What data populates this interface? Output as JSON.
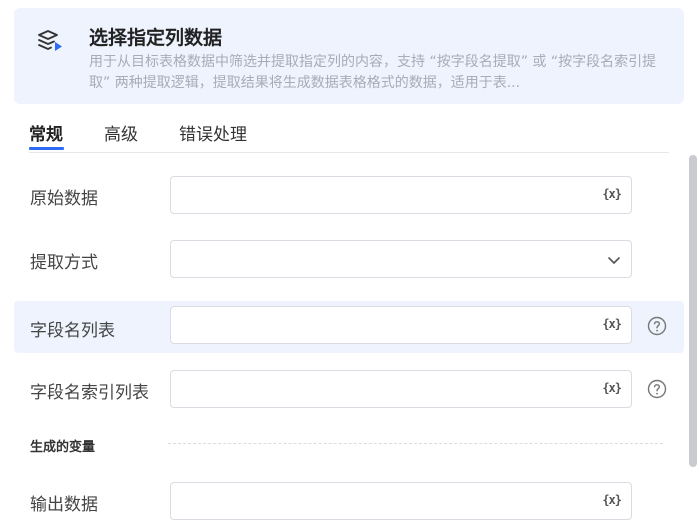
{
  "header": {
    "title": "选择指定列数据",
    "description": "用于从目标表格数据中筛选并提取指定列的内容，支持 “按字段名提取” 或 “按字段名索引提取” 两种提取逻辑，提取结果将生成数据表格格式的数据，适用于表...",
    "icon": "table-select-icon"
  },
  "tabs": [
    {
      "label": "常规",
      "active": true
    },
    {
      "label": "高级",
      "active": false
    },
    {
      "label": "错误处理",
      "active": false
    }
  ],
  "fields": {
    "raw_data": {
      "label": "原始数据",
      "value": "",
      "variable_icon": "{x}"
    },
    "extract_mode": {
      "label": "提取方式",
      "value": ""
    },
    "field_names": {
      "label": "字段名列表",
      "value": "",
      "variable_icon": "{x}"
    },
    "field_index": {
      "label": "字段名索引列表",
      "value": "",
      "variable_icon": "{x}"
    },
    "output": {
      "label": "输出数据",
      "value": "",
      "variable_icon": "{x}"
    }
  },
  "section": {
    "generated_vars": "生成的变量"
  },
  "colors": {
    "accent": "#2d6cf6",
    "highlight": "#eef3fd"
  }
}
